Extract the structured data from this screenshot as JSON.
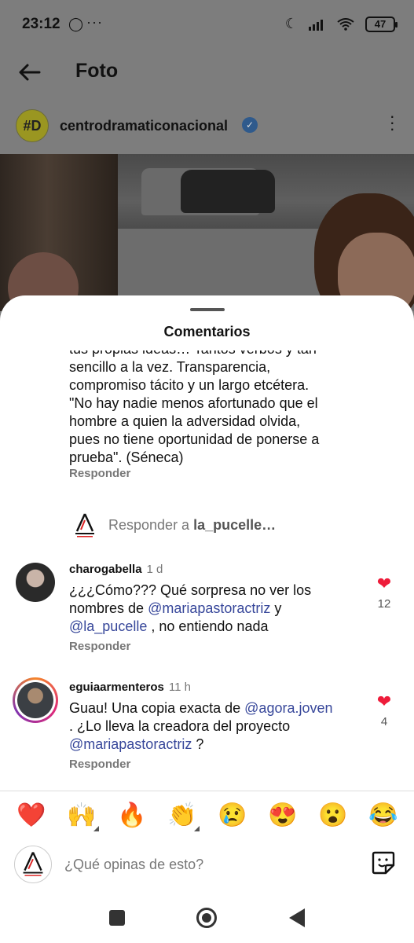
{
  "status_bar": {
    "time": "23:12",
    "notif_dots": "···",
    "battery": "47"
  },
  "app_bar": {
    "title": "Foto"
  },
  "post": {
    "username": "centrodramaticonacional",
    "avatar_text": "#D"
  },
  "sheet": {
    "title": "Comentarios",
    "continued_comment": {
      "text_lines": [
        "tus propias ideas… Tantos verbos y tan",
        "sencillo a la vez. Transparencia,",
        "compromiso tácito y un largo etcétera.",
        "\"No hay nadie menos afortunado que el",
        "hombre a quien la adversidad olvida,",
        "pues no tiene oportunidad de ponerse a",
        "prueba\". (Séneca)"
      ],
      "reply_label": "Responder"
    },
    "reply_to": {
      "prefix": "Responder a ",
      "user": "la_pucelle…"
    },
    "comments": [
      {
        "username": "charogabella",
        "time": "1 d",
        "text_a": "¿¿¿Cómo??? Qué sorpresa no ver los nombres de ",
        "mention1": "@mariapastoractriz",
        "text_b": " y ",
        "mention2": "@la_pucelle",
        "text_c": " , no entiendo nada",
        "likes": "12",
        "reply_label": "Responder"
      },
      {
        "username": "eguiaarmenteros",
        "time": "11 h",
        "text_a": "Guau! Una copia exacta de ",
        "mention1": "@agora.joven",
        "text_b": " . ¿Lo lleva la creadora del proyecto ",
        "mention2": "@mariapastoractriz",
        "text_c": " ?",
        "likes": "4",
        "reply_label": "Responder"
      }
    ],
    "emojis": [
      "❤️",
      "🙌",
      "🔥",
      "👏",
      "😢",
      "😍",
      "😮",
      "😂"
    ],
    "input_placeholder": "¿Qué opinas de esto?"
  },
  "colors": {
    "heart": "#ee1c3a",
    "mention": "#37479a"
  }
}
